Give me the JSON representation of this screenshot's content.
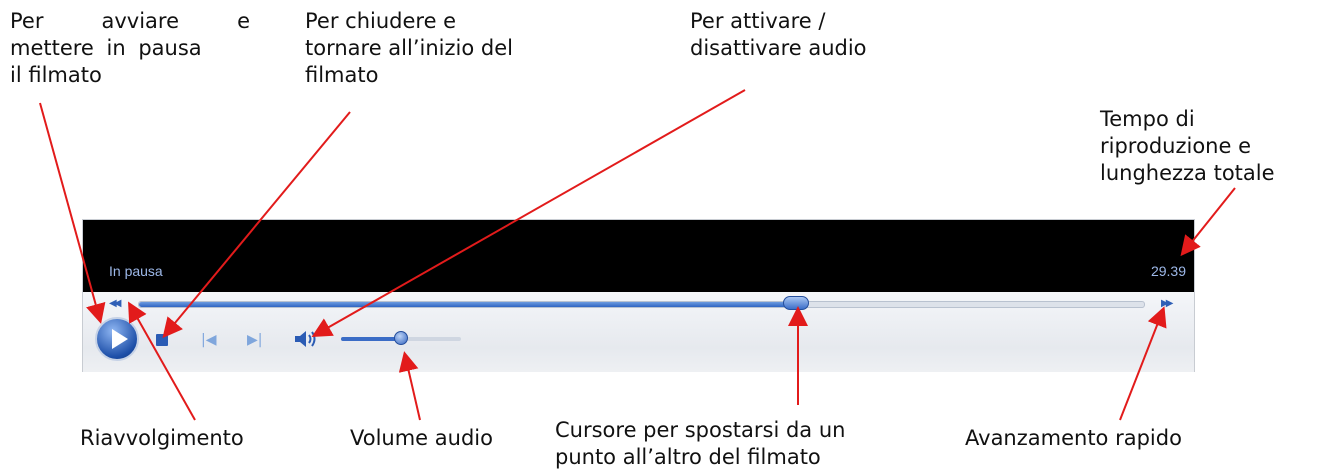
{
  "annotations": {
    "play_line1_a": "Per",
    "play_line1_b": "avviare",
    "play_line1_c": "e",
    "play_line2": "mettere in pausa",
    "play_line3": "il filmato",
    "stop_line1": "Per chiudere e",
    "stop_line2": "tornare all’inizio del",
    "stop_line3": "filmato",
    "mute_line1": "Per attivare /",
    "mute_line2": "disattivare audio",
    "time_line1": "Tempo di",
    "time_line2": "riproduzione e",
    "time_line3": "lunghezza totale",
    "rewind": "Riavvolgimento",
    "volume": "Volume audio",
    "seek_line1": "Cursore per spostarsi da un",
    "seek_line2": "punto all’altro del filmato",
    "ff": "Avanzamento rapido"
  },
  "player": {
    "status": "In pausa",
    "time": "29.39",
    "seek_fraction": 0.655,
    "volume_fraction": 0.5
  },
  "colors": {
    "annotation_arrow": "#e21b1b",
    "accent": "#2f64c2"
  },
  "icons": {
    "play": "play-icon",
    "stop": "stop-icon",
    "prev": "previous-icon",
    "next": "next-icon",
    "mute": "speaker-icon",
    "rewind": "rewind-icon",
    "ff": "fast-forward-icon"
  }
}
